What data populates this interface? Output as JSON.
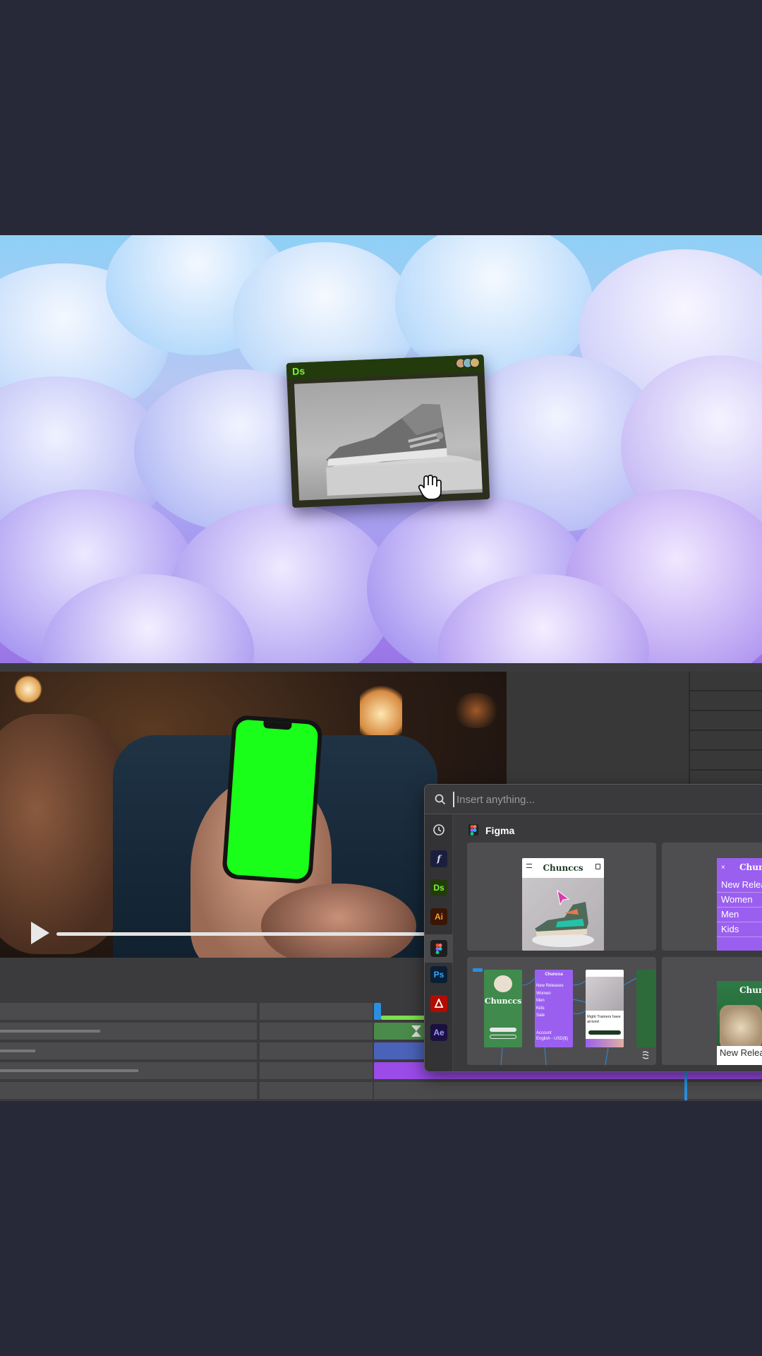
{
  "colors": {
    "page_background": "#282938",
    "ds_accent": "#7ff23a",
    "figma_purple": "#9b5ff0",
    "green_screen": "#1aff1a",
    "playhead": "#2a8fe0"
  },
  "ds_window": {
    "app_badge": "Ds",
    "content": "grey sneaker 3D render"
  },
  "video_player": {
    "play_icon": "play-icon",
    "progress": 0.98
  },
  "quick_insert": {
    "search_placeholder": "Insert anything...",
    "section_label": "Figma",
    "rail_items": [
      {
        "name": "recent-icon",
        "label": ""
      },
      {
        "name": "fonts-icon",
        "label": "f"
      },
      {
        "name": "dimension-icon",
        "label": "Ds"
      },
      {
        "name": "illustrator-icon",
        "label": "Ai"
      },
      {
        "name": "figma-icon",
        "label": ""
      },
      {
        "name": "photoshop-icon",
        "label": "Ps"
      },
      {
        "name": "acrobat-icon",
        "label": ""
      },
      {
        "name": "aftereffects-icon",
        "label": "Ae"
      }
    ],
    "cards": {
      "card1": {
        "brand": "Chunccs"
      },
      "card2": {
        "brand": "Chunc",
        "items": [
          "New Relea",
          "Women",
          "Men",
          "Kids"
        ]
      },
      "card3": {
        "brand": "Chunccs",
        "menu_brand": "Chuncca",
        "menu_items": [
          "New Releases",
          "Women",
          "Men",
          "Kids",
          "Sale"
        ],
        "menu_footer": [
          "Account",
          "English - USD($)"
        ],
        "product_caption": "Right Trainers have arrived"
      },
      "card4": {
        "brand": "Chunc",
        "caption": "New Releas"
      }
    }
  }
}
